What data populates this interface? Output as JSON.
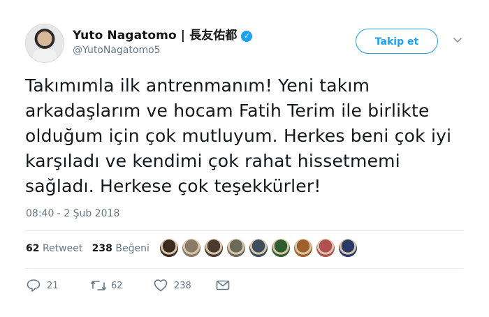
{
  "author": {
    "name": "Yuto Nagatomo | 長友佑都",
    "handle": "@YutoNagatomo5",
    "verified_icon": "verified-badge-icon",
    "avatar_icon": "avatar-photo"
  },
  "follow_button": {
    "label": "Takip et"
  },
  "more_icon": "chevron-down-icon",
  "tweet": {
    "text": "Takımımla ilk antrenmanım! Yeni takım arkadaşlarım ve hocam Fatih Terim ile birlikte olduğum için çok mutluyum. Herkes beni çok iyi karşıladı ve kendimi çok rahat hissetmemi sağladı. Herkese çok teşekkürler!",
    "timestamp": "08:40 - 2 Şub 2018"
  },
  "stats": {
    "retweets_count": "62",
    "retweets_label": "Retweet",
    "likes_count": "238",
    "likes_label": "Beğeni"
  },
  "likers": {
    "colors": [
      "#3b2a20",
      "#8a7a66",
      "#4a3b2e",
      "#6b6b5a",
      "#3d4f5c",
      "#2f5d2f",
      "#a0602a",
      "#b05050",
      "#2a3a6a"
    ]
  },
  "actions": {
    "reply_count": "21",
    "retweet_count": "62",
    "like_count": "238"
  },
  "colors": {
    "accent": "#1da1f2",
    "text": "#14171a",
    "muted": "#657786"
  }
}
